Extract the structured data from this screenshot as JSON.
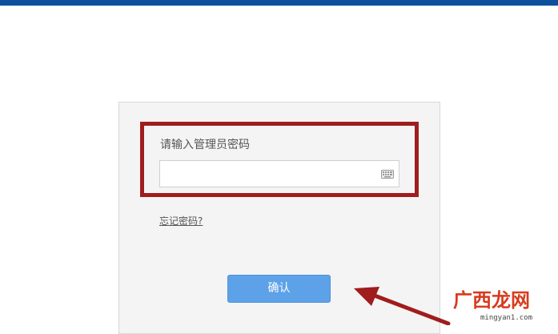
{
  "login": {
    "password_label": "请输入管理员密码",
    "password_value": "",
    "forgot_link": "忘记密码?",
    "confirm_button": "确认"
  },
  "icons": {
    "input_icon": "keyboard-icon",
    "annotation": "red-arrow-icon"
  },
  "colors": {
    "top_bar": "#0d4f9c",
    "highlight": "#a01d1d",
    "button": "#5da2e8"
  },
  "watermark": {
    "name": "广西龙网",
    "url": "mingyan1.com"
  }
}
